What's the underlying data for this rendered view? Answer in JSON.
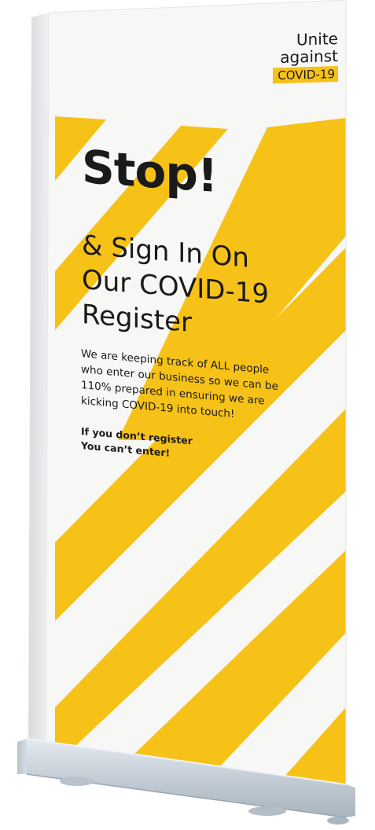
{
  "banner": {
    "brand": {
      "line1": "Unite",
      "line2": "against",
      "tag": "COVID-19"
    },
    "headline": "Stop!",
    "subheading": [
      "& Sign In On",
      "Our COVID-19",
      "Register"
    ],
    "body": [
      "We are keeping track of ALL people",
      "who enter our business so we can be",
      "110% prepared in ensuring we are",
      "kicking COVID-19 into touch!"
    ],
    "warning": [
      "If you don’t register",
      "You can’t enter!"
    ]
  },
  "colors": {
    "accent_yellow": "#f7c218",
    "banner_white": "#f7f7f6",
    "text_dark": "#1a1a1a",
    "stand_metal": "#c9d3dc"
  }
}
